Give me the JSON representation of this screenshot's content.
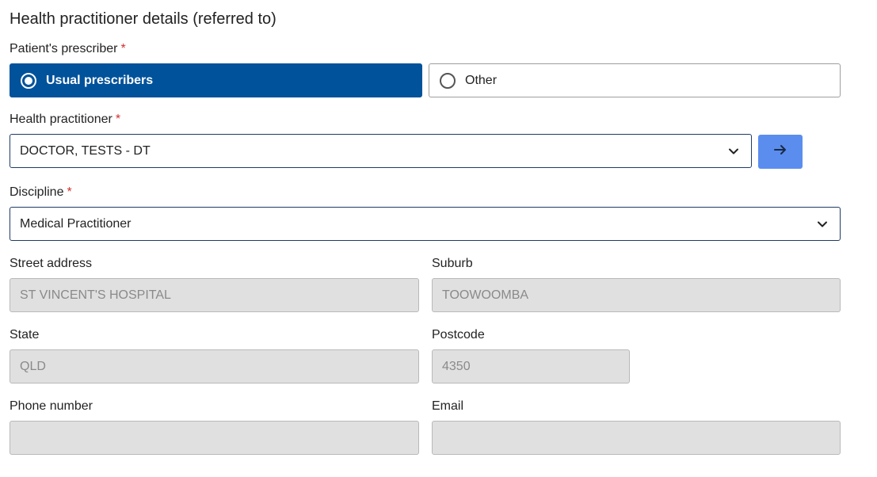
{
  "section": {
    "title": "Health practitioner details (referred to)"
  },
  "required_marker": "*",
  "prescriber": {
    "label": "Patient's prescriber",
    "options": [
      {
        "label": "Usual prescribers",
        "selected": true
      },
      {
        "label": "Other",
        "selected": false
      }
    ]
  },
  "practitioner": {
    "label": "Health practitioner",
    "value": "DOCTOR, TESTS - DT",
    "go_icon": "arrow-right-icon"
  },
  "discipline": {
    "label": "Discipline",
    "value": "Medical Practitioner"
  },
  "address": {
    "street_label": "Street address",
    "street_value": "ST VINCENT'S HOSPITAL",
    "suburb_label": "Suburb",
    "suburb_value": "TOOWOOMBA",
    "state_label": "State",
    "state_value": "QLD",
    "postcode_label": "Postcode",
    "postcode_value": "4350"
  },
  "contact": {
    "phone_label": "Phone number",
    "phone_value": "",
    "email_label": "Email",
    "email_value": ""
  },
  "colors": {
    "selected_option": "#00529b",
    "go_button": "#5b8def",
    "required": "#d32f2f",
    "readonly_bg": "#e0e0e0"
  }
}
